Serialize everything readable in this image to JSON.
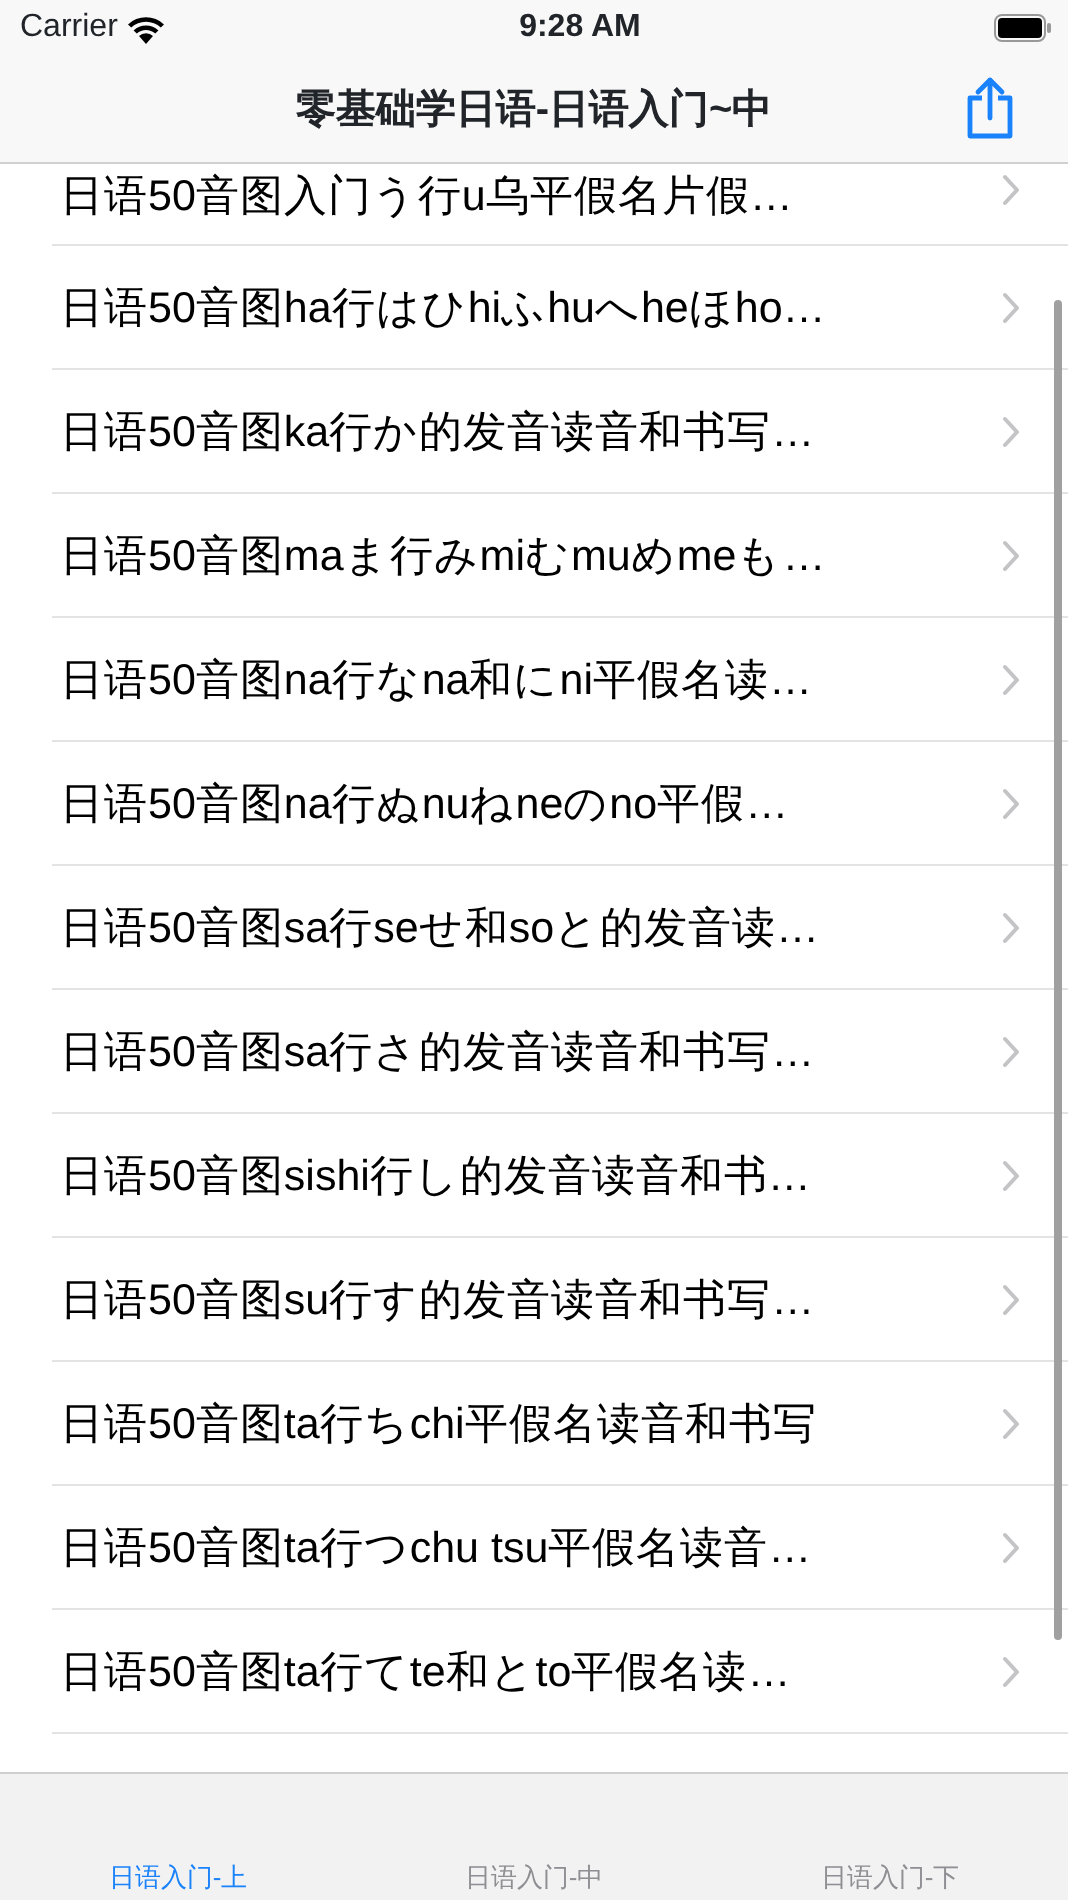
{
  "status_bar": {
    "carrier": "Carrier",
    "time": "9:28 AM"
  },
  "nav_bar": {
    "title": "零基础学日语-日语入门~中"
  },
  "list": {
    "items": [
      {
        "title": "日语50音图入门う行u乌平假名片假…"
      },
      {
        "title": "日语50音图ha行はひhiふhuへheほho…"
      },
      {
        "title": "日语50音图ka行か的发音读音和书写…"
      },
      {
        "title": "日语50音图maま行みmiむmuめmeも…"
      },
      {
        "title": "日语50音图na行なna和にni平假名读…"
      },
      {
        "title": "日语50音图na行ぬnuねneのno平假…"
      },
      {
        "title": "日语50音图sa行seせ和soと的发音读…"
      },
      {
        "title": "日语50音图sa行さ的发音读音和书写…"
      },
      {
        "title": "日语50音图sishi行し的发音读音和书…"
      },
      {
        "title": "日语50音图su行す的发音读音和书写…"
      },
      {
        "title": "日语50音图ta行ちchi平假名读音和书写"
      },
      {
        "title": "日语50音图ta行つchu tsu平假名读音…"
      },
      {
        "title": "日语50音图ta行てte和とto平假名读…"
      }
    ]
  },
  "tab_bar": {
    "tabs": [
      {
        "label": "日语入门-上",
        "selected": true
      },
      {
        "label": "日语入门-中",
        "selected": false
      },
      {
        "label": "日语入门-下",
        "selected": false
      }
    ]
  }
}
